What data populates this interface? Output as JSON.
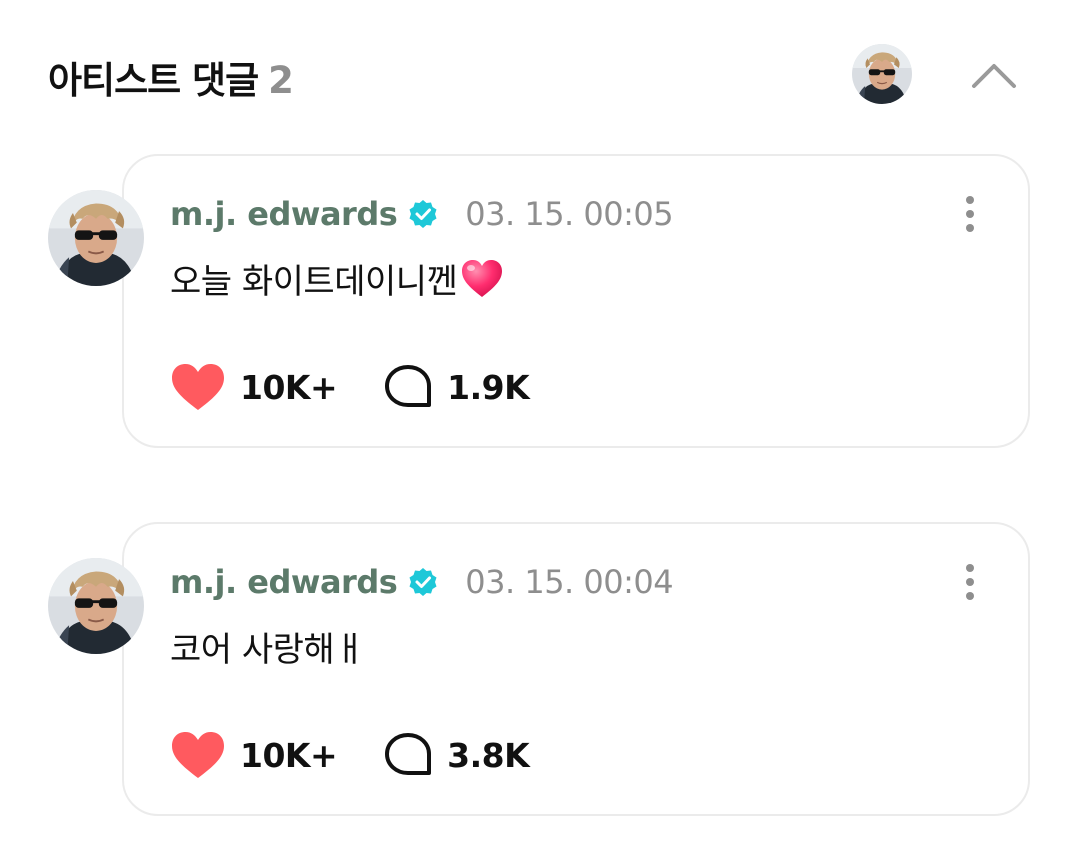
{
  "header": {
    "title": "아티스트 댓글",
    "count": "2"
  },
  "colors": {
    "author": "#5c7a6a",
    "verified": "#1ec8d8",
    "like": "#ff5a5f",
    "meta": "#8e8e8e",
    "card_border": "#ebebeb"
  },
  "comments": [
    {
      "author": "m.j. edwards",
      "verified_icon": "verified-badge-icon",
      "timestamp": "03. 15. 00:05",
      "text": "오늘 화이트데이니껜",
      "emoji": "heart-emoji",
      "likes": "10K+",
      "replies": "1.9K"
    },
    {
      "author": "m.j. edwards",
      "verified_icon": "verified-badge-icon",
      "timestamp": "03. 15. 00:04",
      "text": "코어 사랑해ㅐ",
      "likes": "10K+",
      "replies": "3.8K"
    }
  ]
}
